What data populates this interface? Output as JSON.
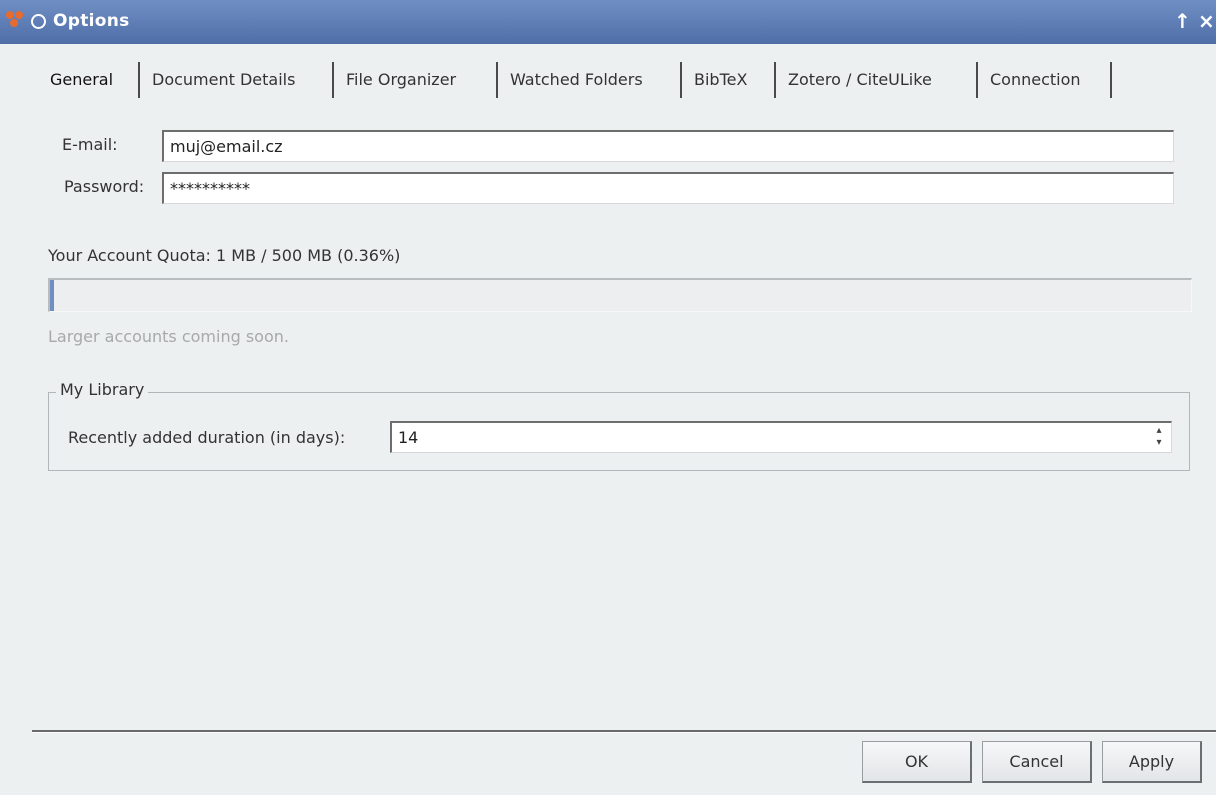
{
  "window": {
    "title": "Options",
    "app_icon": "mendeley-icon",
    "buttons": [
      "up-arrow-icon",
      "close-icon"
    ]
  },
  "tabs": [
    {
      "label": "General",
      "active": true
    },
    {
      "label": "Document Details"
    },
    {
      "label": "File Organizer"
    },
    {
      "label": "Watched Folders"
    },
    {
      "label": "BibTeX"
    },
    {
      "label": "Zotero / CiteULike"
    },
    {
      "label": "Connection"
    }
  ],
  "account": {
    "email_label": "E-mail:",
    "email_value": "muj@email.cz",
    "password_label": "Password:",
    "password_value": "**********"
  },
  "quota": {
    "text": "Your Account Quota: 1 MB / 500 MB (0.36%)",
    "percent": 0.36,
    "note": "Larger accounts coming soon."
  },
  "library": {
    "group_title": "My Library",
    "duration_label": "Recently added duration (in days):",
    "duration_value": "14"
  },
  "buttons": {
    "ok": "OK",
    "cancel": "Cancel",
    "apply": "Apply"
  },
  "colors": {
    "titlebar": "#5a79b2",
    "background": "#edf0f1"
  }
}
